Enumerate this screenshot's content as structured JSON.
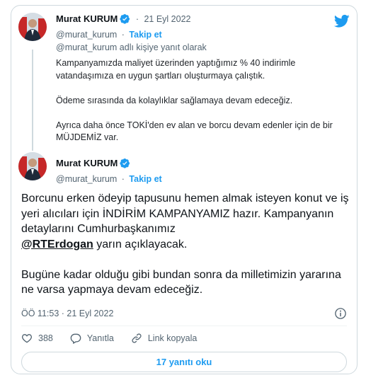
{
  "colors": {
    "accent": "#1d9bf0",
    "text": "#0f1419",
    "muted": "#536471",
    "border": "#cfd9de"
  },
  "quoted_tweet": {
    "author_name": "Murat KURUM",
    "separator": "·",
    "date": "21 Eyl 2022",
    "handle": "@murat_kurum",
    "follow_label": "Takip et",
    "reply_context": "@murat_kurum adlı kişiye yanıt olarak",
    "paragraphs": [
      "Kampanyamızda maliyet üzerinden yaptığımız % 40 indirimle vatandaşımıza en uygun şartları oluşturmaya çalıştık.",
      "Ödeme sırasında da kolaylıklar sağlamaya devam edeceğiz.",
      "Ayrıca daha önce TOKİ'den ev alan ve borcu devam edenler için de bir MÜJDEMİZ var."
    ]
  },
  "main_tweet": {
    "author_name": "Murat KURUM",
    "handle": "@murat_kurum",
    "follow_label": "Takip et",
    "text_p1": "Borcunu erken ödeyip tapusunu hemen almak isteyen konut ve iş yeri alıcıları için İNDİRİM KAMPANYAMIZ hazır. Kampanyanın detaylarını Cumhurbaşkanımız",
    "mention": "@RTErdogan",
    "text_p1_end": "yarın açıklayacak.",
    "text_p2": "Bugüne kadar olduğu gibi bundan sonra da milletimizin yararına ne varsa yapmaya devam edeceğiz.",
    "timestamp": "ÖÖ 11:53 · 21 Eyl 2022"
  },
  "actions": {
    "like_count": "388",
    "reply_label": "Yanıtla",
    "copy_link_label": "Link kopyala"
  },
  "read_replies_label": "17 yanıtı oku",
  "icons": [
    "verified-icon",
    "twitter-logo-icon",
    "info-icon",
    "heart-icon",
    "reply-icon",
    "link-icon"
  ]
}
